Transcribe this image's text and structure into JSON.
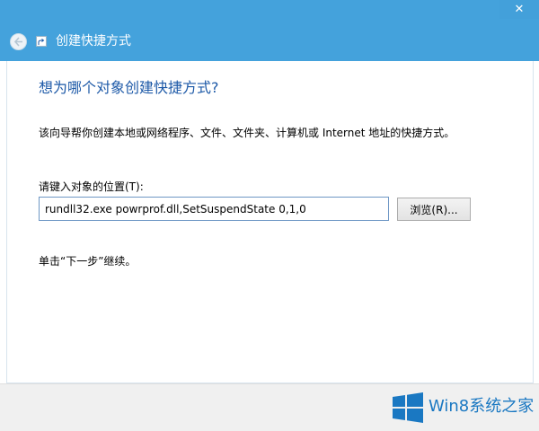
{
  "window": {
    "title": "创建快捷方式",
    "close_glyph": "✕"
  },
  "wizard": {
    "heading": "想为哪个对象创建快捷方式?",
    "description": "该向导帮你创建本地或网络程序、文件、文件夹、计算机或 Internet 地址的快捷方式。",
    "location_label": "请键入对象的位置(T):",
    "location_value": "rundll32.exe powrprof.dll,SetSuspendState 0,1,0",
    "browse_label": "浏览(R)...",
    "hint": "单击“下一步”继续。"
  },
  "watermark": {
    "text": "Win8系统之家"
  },
  "colors": {
    "titlebar": "#44a2dc",
    "heading": "#1e5aa8",
    "watermark": "#1a78c2"
  },
  "icons": [
    "back-arrow-icon",
    "shortcut-app-icon",
    "close-icon",
    "windows-logo-icon"
  ]
}
